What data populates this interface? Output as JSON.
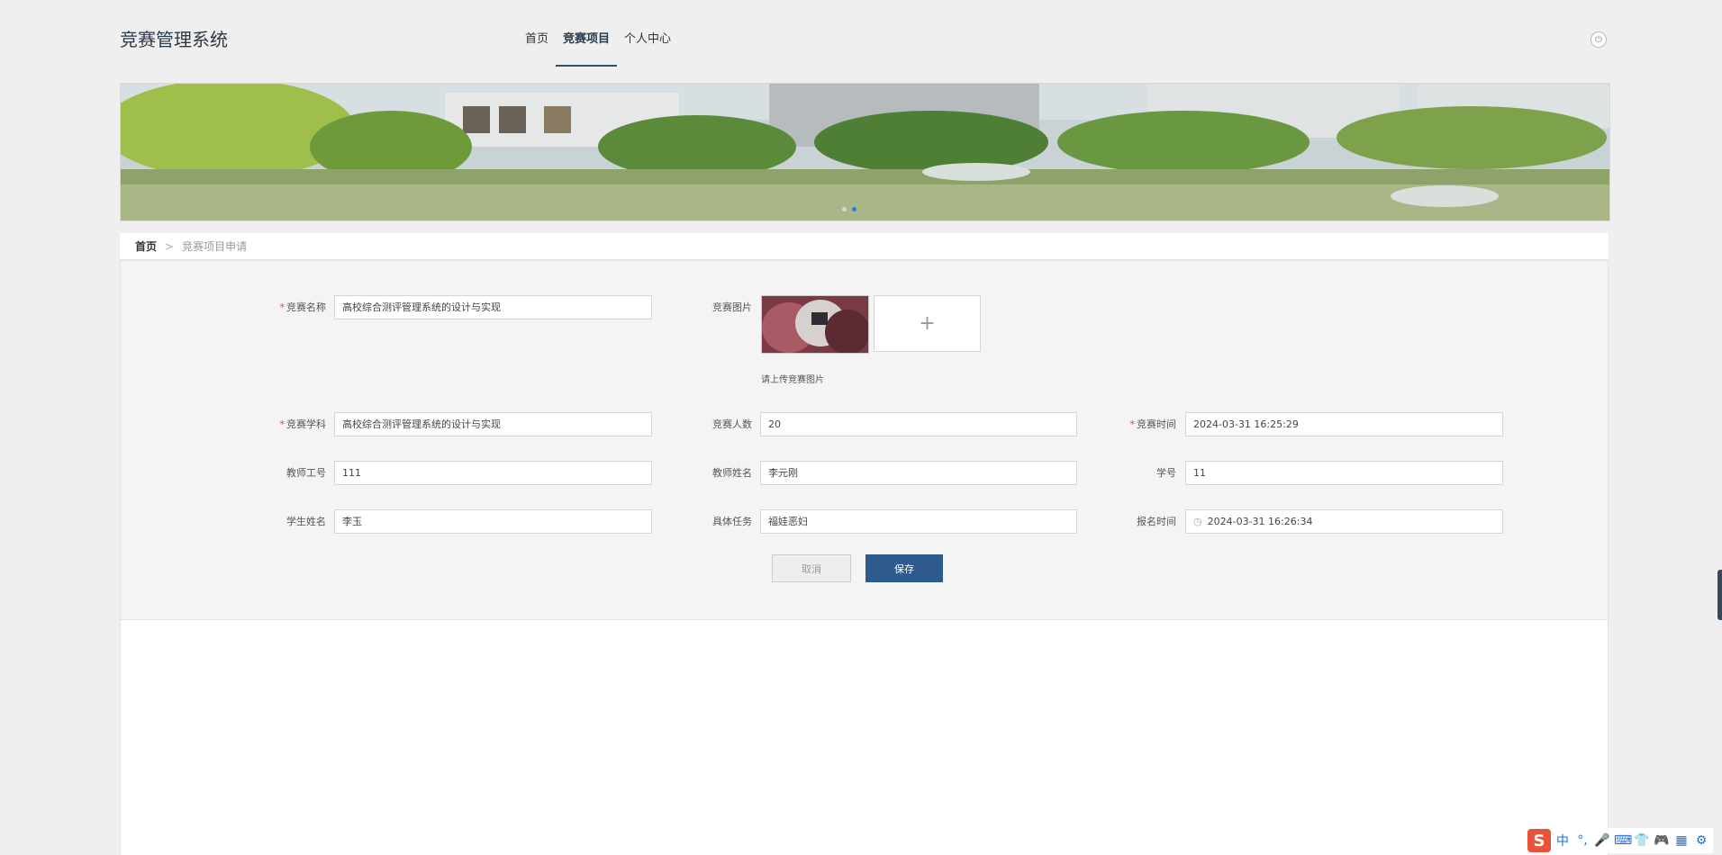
{
  "app": {
    "title": "竞赛管理系统"
  },
  "nav": {
    "items": [
      "首页",
      "竞赛项目",
      "个人中心"
    ],
    "active_index": 1
  },
  "header": {
    "power_icon": "power-icon"
  },
  "carousel": {
    "slide_count": 2,
    "active_slide": 2
  },
  "breadcrumb": {
    "home": "首页",
    "separator": ">",
    "current": "竞赛项目申请"
  },
  "form": {
    "competition_name": {
      "label": "竞赛名称",
      "required": true,
      "value": "高校综合测评管理系统的设计与实现"
    },
    "competition_image": {
      "label": "竞赛图片",
      "hint": "请上传竞赛图片",
      "upload_icon": "+"
    },
    "subject": {
      "label": "竞赛学科",
      "required": true,
      "value": "高校综合测评管理系统的设计与实现"
    },
    "participants": {
      "label": "竞赛人数",
      "value": "20"
    },
    "competition_time": {
      "label": "竞赛时间",
      "required": true,
      "value": "2024-03-31 16:25:29"
    },
    "teacher_id": {
      "label": "教师工号",
      "value": "111"
    },
    "teacher_name": {
      "label": "教师姓名",
      "value": "李元刚"
    },
    "student_id": {
      "label": "学号",
      "value": "11"
    },
    "student_name": {
      "label": "学生姓名",
      "value": "李玉"
    },
    "task": {
      "label": "具体任务",
      "value": "福娃恶妇"
    },
    "signup_time": {
      "label": "报名时间",
      "value": "2024-03-31 16:26:34"
    },
    "cancel_label": "取消",
    "save_label": "保存"
  },
  "taskbar": {
    "ime": {
      "logo": "S",
      "items": [
        "中",
        "°,",
        "🎤",
        "⌨",
        "👕",
        "🎮",
        "▦",
        "⚙"
      ]
    }
  },
  "colors": {
    "accent": "#2e5b8d",
    "required": "#e0443a",
    "carousel_dot_active": "#2e7fd1"
  }
}
